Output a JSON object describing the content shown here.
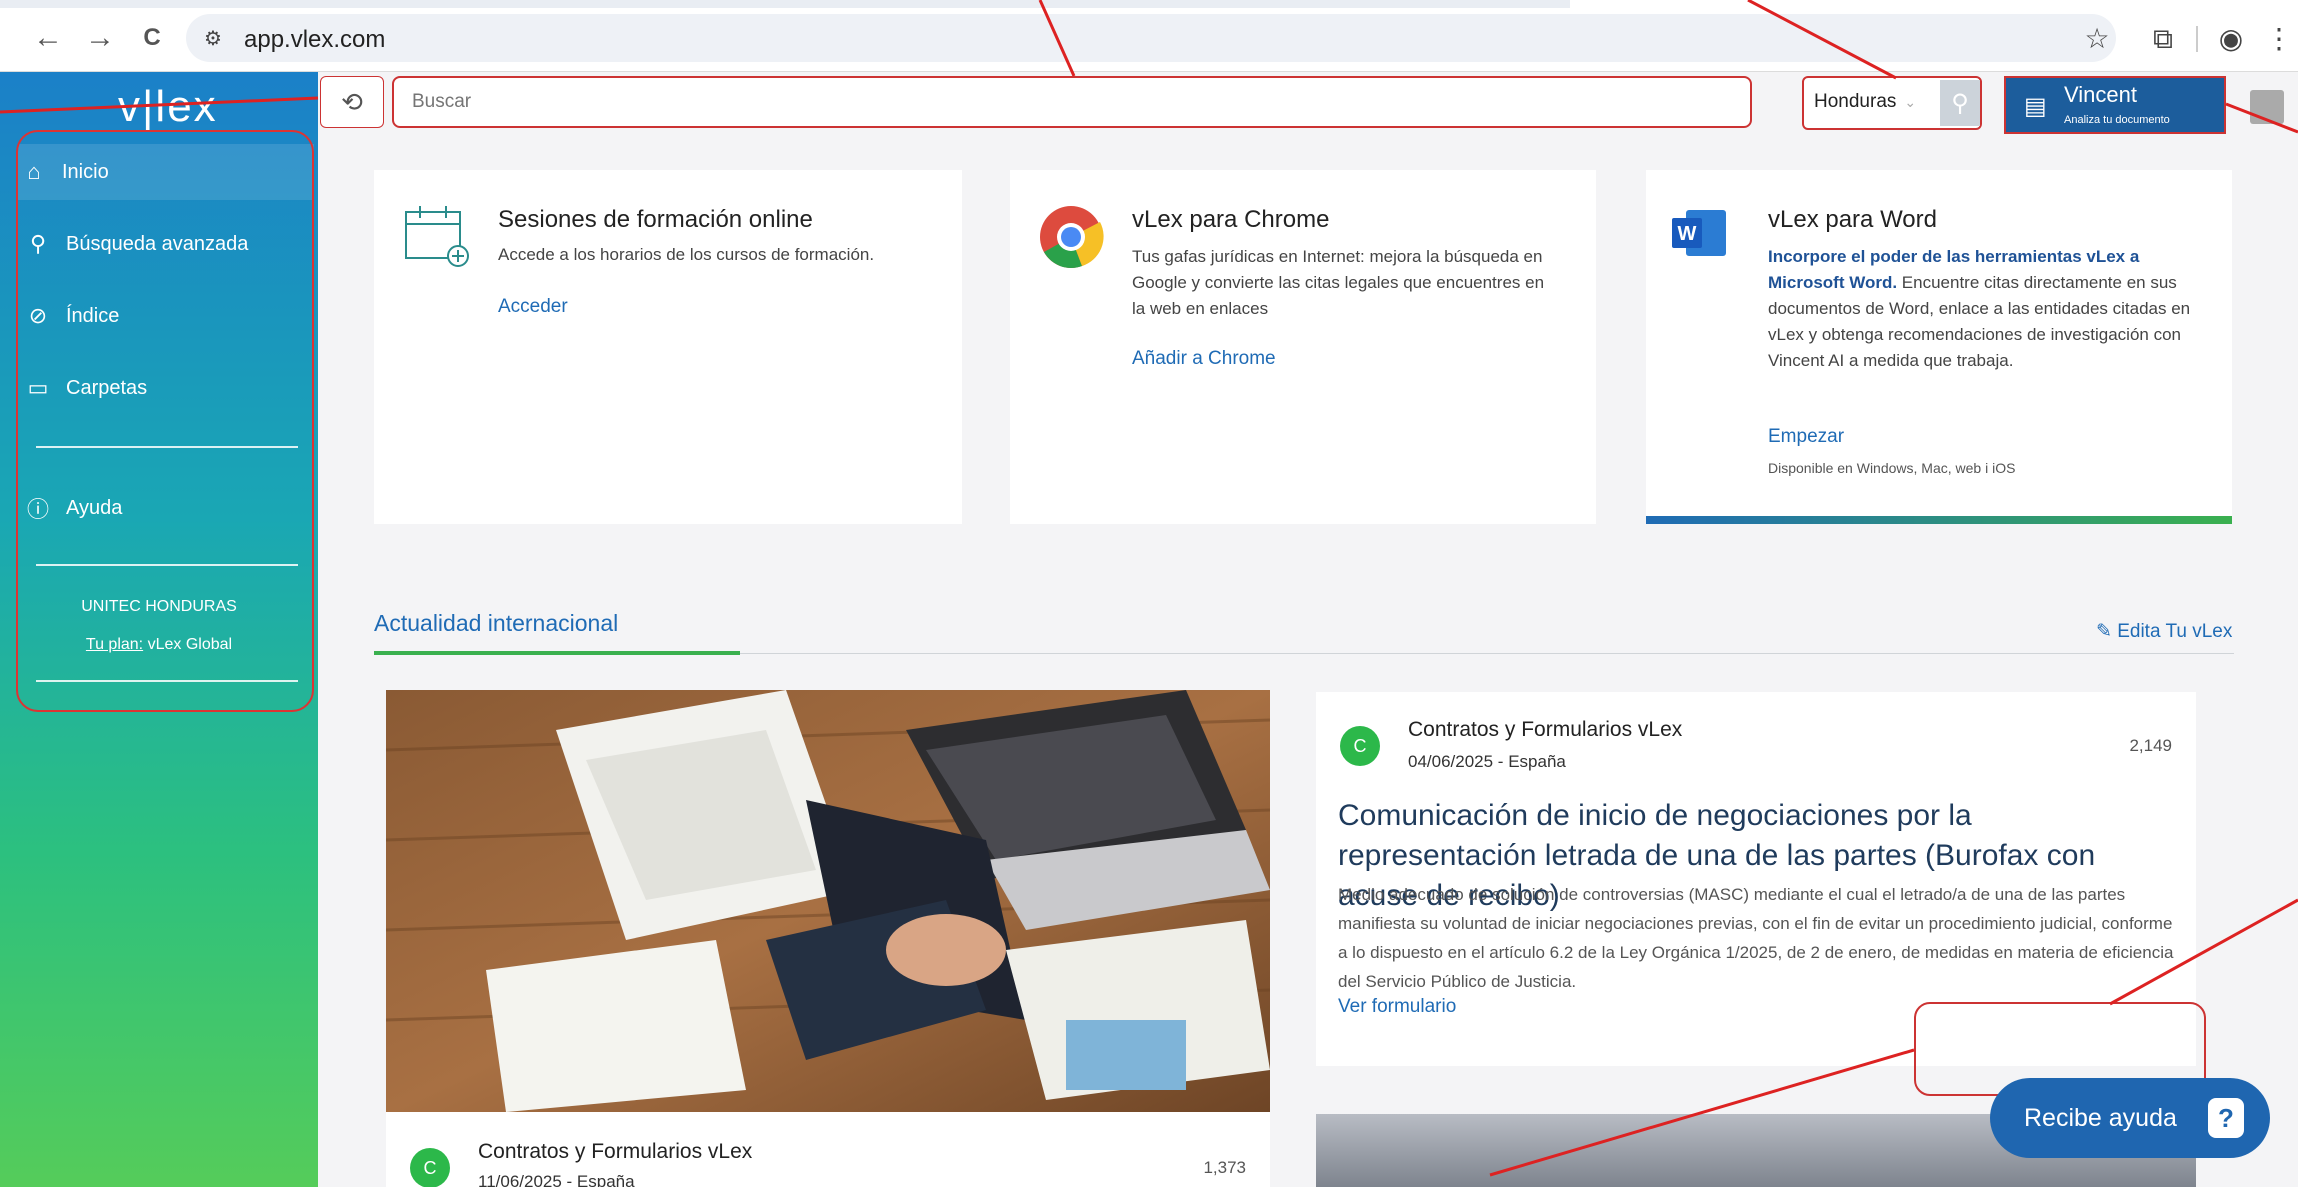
{
  "browser": {
    "url": "app.vlex.com",
    "back": "←",
    "forward": "→",
    "reload": "C"
  },
  "sidebar": {
    "logo": "v|lex",
    "items": [
      {
        "label": "Inicio",
        "icon": "home-icon"
      },
      {
        "label": "Búsqueda avanzada",
        "icon": "search-icon"
      },
      {
        "label": "Índice",
        "icon": "compass-icon"
      },
      {
        "label": "Carpetas",
        "icon": "folder-icon"
      },
      {
        "label": "Ayuda",
        "icon": "help-icon"
      }
    ],
    "org": "UNITEC HONDURAS",
    "plan_label": "Tu plan:",
    "plan_value": "vLex Global"
  },
  "topbar": {
    "search_placeholder": "Buscar",
    "country": "Honduras",
    "vincent_name": "Vincent",
    "vincent_sub": "Analiza tu documento"
  },
  "cards": [
    {
      "title": "Sesiones de formación online",
      "text": "Accede a los horarios de los cursos de formación.",
      "link": "Acceder"
    },
    {
      "title": "vLex para Chrome",
      "text": "Tus gafas jurídicas en Internet: mejora la búsqueda en Google y convierte las citas legales que encuentres en la web en enlaces",
      "link": "Añadir a Chrome"
    },
    {
      "title": "vLex para Word",
      "text_bold": "Incorpore el poder de las herramientas vLex a Microsoft Word.",
      "text": " Encuentre citas directamente en sus documentos de Word, enlace a las entidades citadas en vLex y obtenga recomendaciones de investigación con Vincent AI a medida que trabaja.",
      "link": "Empezar",
      "note": "Disponible en Windows, Mac, web i iOS"
    }
  ],
  "section": {
    "title": "Actualidad internacional",
    "edit": "Edita Tu vLex"
  },
  "news": [
    {
      "source": "Contratos y Formularios vLex",
      "date": "04/06/2025 - España",
      "count": "2,149",
      "title": "Comunicación de inicio de negociaciones por la representación letrada de una de las partes (Burofax con acuse de recibo)",
      "summary": "Medio adecuado de solución de controversias (MASC) mediante el cual el letrado/a de una de las partes manifiesta su voluntad de iniciar negociaciones previas, con el fin de evitar un procedimiento judicial, conforme a lo dispuesto en el artículo 6.2 de la Ley Orgánica 1/2025, de 2 de enero, de medidas en materia de eficiencia del Servicio Público de Justicia.",
      "link": "Ver formulario"
    },
    {
      "source": "Contratos y Formularios vLex",
      "date": "11/06/2025 - España",
      "count": "1,373"
    }
  ],
  "help": {
    "label": "Recibe ayuda",
    "icon": "?"
  },
  "colors": {
    "brand_blue": "#1f6bb5",
    "vincent_bg": "#1c5d9c",
    "annotation_red": "#cc3333",
    "badge_green": "#2cb84a"
  }
}
